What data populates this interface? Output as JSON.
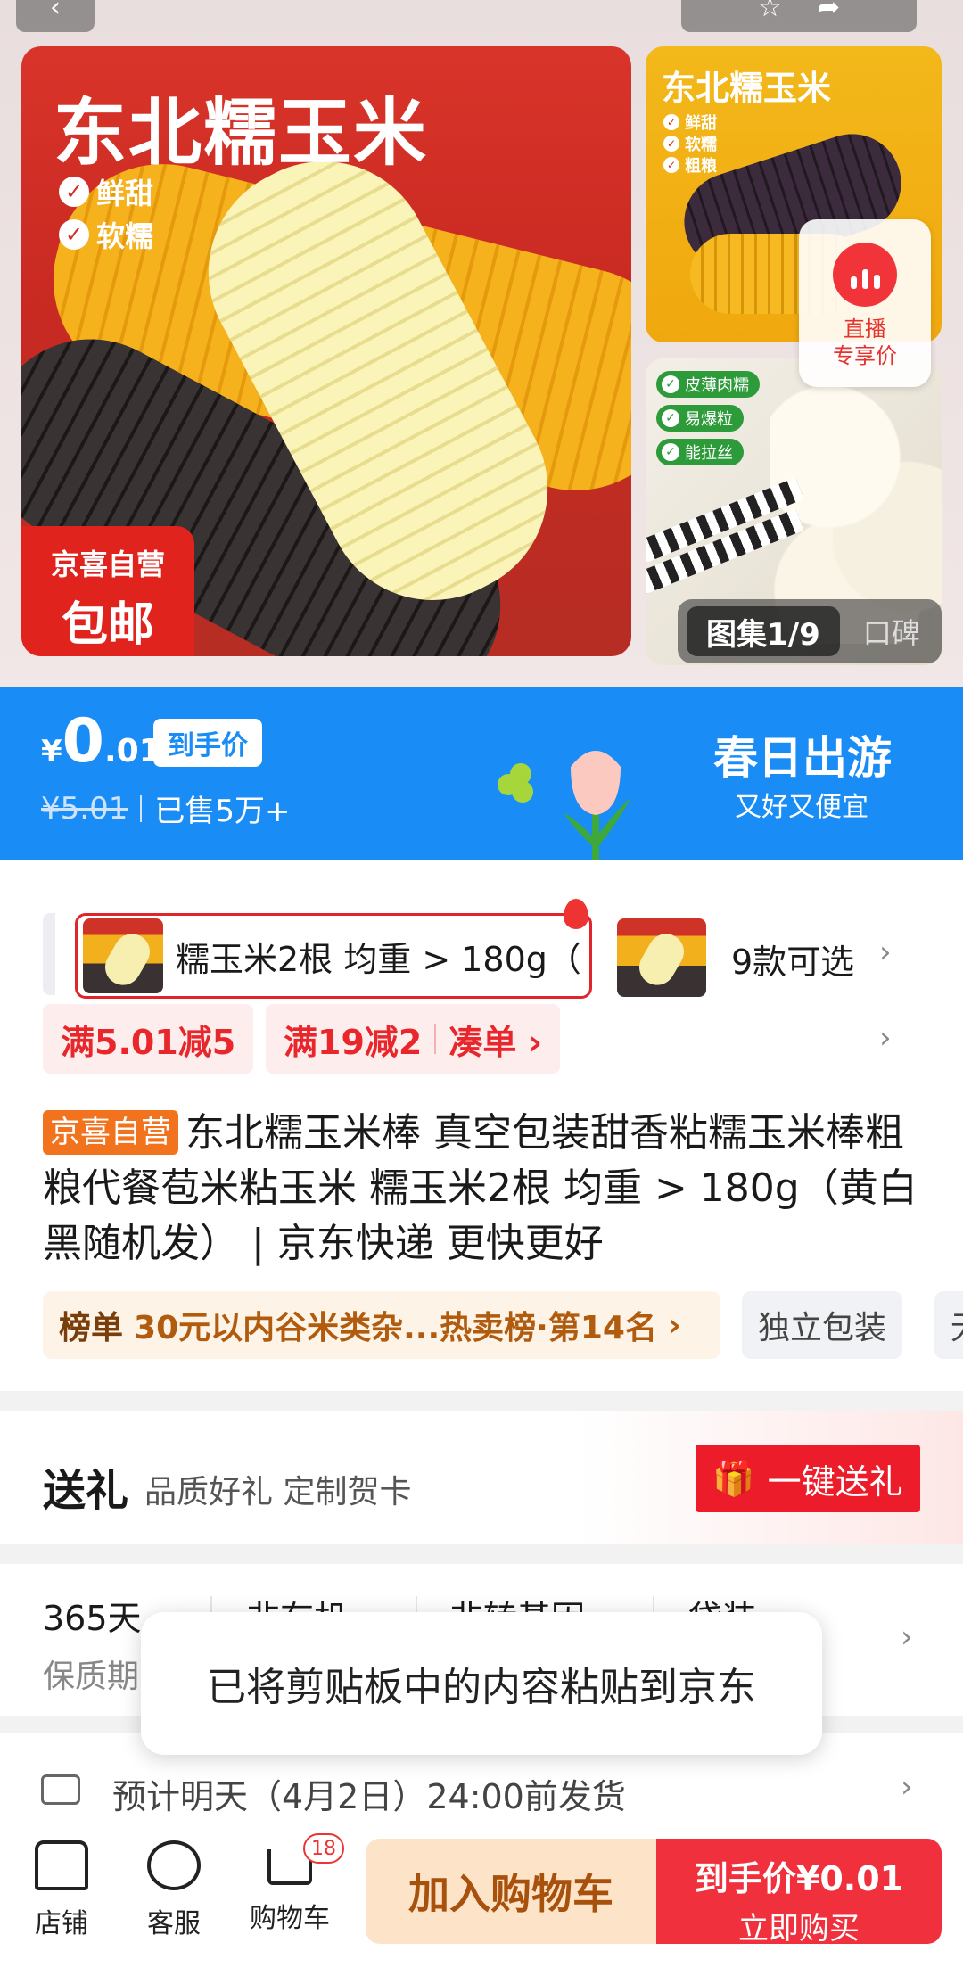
{
  "gallery": {
    "main_title": "东北糯玉米",
    "main_checks": [
      "鲜甜",
      "软糯"
    ],
    "badge_line1": "京喜自营",
    "badge_line2": "包邮",
    "side1_title": "东北糯玉米",
    "side1_checks": [
      "鲜甜",
      "软糯",
      "粗粮"
    ],
    "live_line1": "直播",
    "live_line2": "专享价",
    "side2_tags": [
      "皮薄肉糯",
      "易爆粒",
      "能拉丝"
    ],
    "counter": "图集1/9",
    "review_tab": "口碑"
  },
  "price": {
    "currency": "¥",
    "integer": "0",
    "decimal": ".01",
    "pill": "到手价",
    "original": "¥5.01",
    "sold": "已售5万+",
    "spring_title": "春日出游",
    "spring_sub": "又好又便宜"
  },
  "spec": {
    "selected": "糯玉米2根 均重 > 180g（",
    "count": "9款可选"
  },
  "promos": {
    "p1": "满5.01减5",
    "p2": "满19减2",
    "p2_link": "凑单 ›"
  },
  "title": {
    "tag": "京喜自营",
    "text": "东北糯玉米棒 真空包装甜香粘糯玉米棒粗粮代餐苞米粘玉米 糯玉米2根 均重 > 180g（黄白黑随机发） | 京东快递 更快更好"
  },
  "rank": {
    "key": "榜单",
    "text": "30元以内谷米类杂...热卖榜·第14名",
    "feature1": "独立包装",
    "feature2": "无"
  },
  "gift": {
    "title": "送礼",
    "sub": "品质好礼 定制贺卡",
    "button": "一键送礼"
  },
  "params": [
    {
      "value": "365天",
      "key": "保质期"
    },
    {
      "value": "非有机",
      "key": ""
    },
    {
      "value": "非转基因",
      "key": ""
    },
    {
      "value": "袋装",
      "key": ""
    }
  ],
  "delivery": {
    "text": "预计明天（4月2日）24:00前发货"
  },
  "toast": {
    "text": "已将剪贴板中的内容粘贴到京东"
  },
  "bottom": {
    "store": "店铺",
    "service": "客服",
    "cart": "购物车",
    "cart_count": "18",
    "add_cart": "加入购物车",
    "buy_line1": "到手价¥0.01",
    "buy_line2": "立即购买"
  }
}
